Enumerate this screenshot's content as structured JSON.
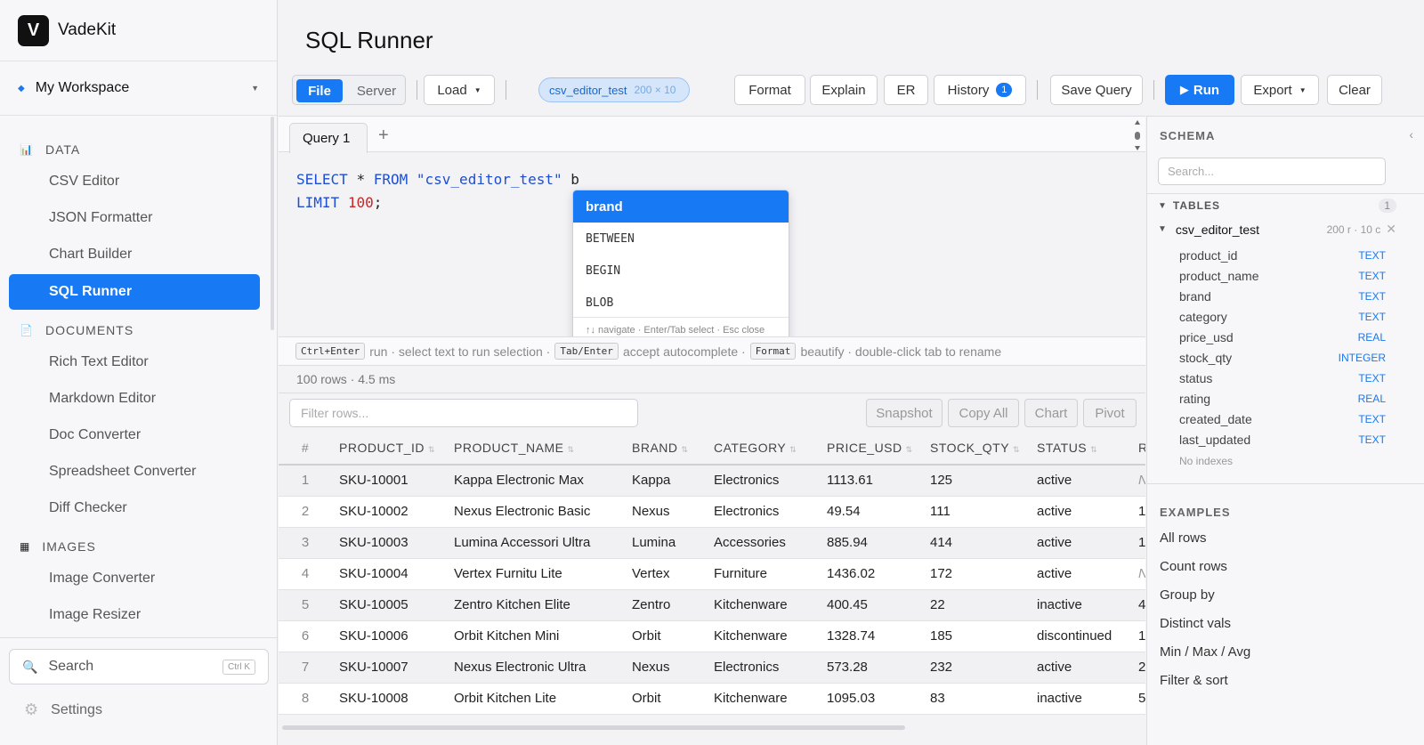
{
  "app": {
    "name": "VadeKit",
    "logo_letter": "V"
  },
  "workspace": {
    "label": "My Workspace"
  },
  "sidebar": {
    "sections": [
      {
        "label": "DATA",
        "icon": "chart-icon",
        "items": [
          "CSV Editor",
          "JSON Formatter",
          "Chart Builder",
          "SQL Runner"
        ]
      },
      {
        "label": "DOCUMENTS",
        "icon": "document-icon",
        "items": [
          "Rich Text Editor",
          "Markdown Editor",
          "Doc Converter",
          "Spreadsheet Converter",
          "Diff Checker"
        ]
      },
      {
        "label": "IMAGES",
        "icon": "image-icon",
        "items": [
          "Image Converter",
          "Image Resizer"
        ]
      }
    ],
    "active_item": "SQL Runner",
    "search": {
      "label": "Search",
      "shortcut": "Ctrl K"
    },
    "settings_label": "Settings"
  },
  "page": {
    "title": "SQL Runner"
  },
  "toolbar": {
    "source_options": [
      "File",
      "Server"
    ],
    "source_selected": "File",
    "load_label": "Load",
    "table_chip": {
      "name": "csv_editor_test",
      "dims": "200 × 10"
    },
    "format_label": "Format",
    "explain_label": "Explain",
    "er_label": "ER",
    "history_label": "History",
    "history_count": "1",
    "save_label": "Save Query",
    "run_label": "Run",
    "export_label": "Export",
    "clear_label": "Clear"
  },
  "editor": {
    "tab_label": "Query 1",
    "add_tab": "+",
    "code": {
      "line1": {
        "select": "SELECT",
        "star": "*",
        "from": "FROM",
        "table": "\"csv_editor_test\"",
        "rest": "b"
      },
      "line2": {
        "limit": "LIMIT",
        "num": "100",
        "end": ";"
      }
    },
    "autocomplete": {
      "items": [
        "brand",
        "BETWEEN",
        "BEGIN",
        "BLOB"
      ],
      "selected": "brand",
      "footer": "↑↓ navigate · Enter/Tab select · Esc close"
    },
    "hints": {
      "k1": "Ctrl+Enter",
      "t1": "run · select text to run selection ·",
      "k2": "Tab/Enter",
      "t2": "accept autocomplete ·",
      "k3": "Format",
      "t3": "beautify · double-click tab to rename"
    }
  },
  "results": {
    "status": "100 rows · 4.5 ms",
    "filter_placeholder": "Filter rows...",
    "actions": [
      "Snapshot",
      "Copy All",
      "Chart",
      "Pivot"
    ],
    "columns": [
      "#",
      "PRODUCT_ID",
      "PRODUCT_NAME",
      "BRAND",
      "CATEGORY",
      "PRICE_USD",
      "STOCK_QTY",
      "STATUS",
      "RA"
    ],
    "rows": [
      [
        "1",
        "SKU-10001",
        "Kappa Electronic Max",
        "Kappa",
        "Electronics",
        "1113.61",
        "125",
        "active",
        "N"
      ],
      [
        "2",
        "SKU-10002",
        "Nexus Electronic Basic",
        "Nexus",
        "Electronics",
        "49.54",
        "111",
        "active",
        "1."
      ],
      [
        "3",
        "SKU-10003",
        "Lumina Accessori Ultra",
        "Lumina",
        "Accessories",
        "885.94",
        "414",
        "active",
        "1."
      ],
      [
        "4",
        "SKU-10004",
        "Vertex Furnitu Lite",
        "Vertex",
        "Furniture",
        "1436.02",
        "172",
        "active",
        "N"
      ],
      [
        "5",
        "SKU-10005",
        "Zentro Kitchen Elite",
        "Zentro",
        "Kitchenware",
        "400.45",
        "22",
        "inactive",
        "4."
      ],
      [
        "6",
        "SKU-10006",
        "Orbit Kitchen Mini",
        "Orbit",
        "Kitchenware",
        "1328.74",
        "185",
        "discontinued",
        "1."
      ],
      [
        "7",
        "SKU-10007",
        "Nexus Electronic Ultra",
        "Nexus",
        "Electronics",
        "573.28",
        "232",
        "active",
        "2."
      ],
      [
        "8",
        "SKU-10008",
        "Orbit Kitchen Lite",
        "Orbit",
        "Kitchenware",
        "1095.03",
        "83",
        "inactive",
        "5"
      ]
    ]
  },
  "schema": {
    "title": "SCHEMA",
    "collapse": "‹",
    "search_placeholder": "Search...",
    "tables_label": "TABLES",
    "tables_count": "1",
    "table": {
      "name": "csv_editor_test",
      "meta": "200 r · 10 c"
    },
    "columns": [
      {
        "name": "product_id",
        "type": "TEXT"
      },
      {
        "name": "product_name",
        "type": "TEXT"
      },
      {
        "name": "brand",
        "type": "TEXT"
      },
      {
        "name": "category",
        "type": "TEXT"
      },
      {
        "name": "price_usd",
        "type": "REAL"
      },
      {
        "name": "stock_qty",
        "type": "INTEGER"
      },
      {
        "name": "status",
        "type": "TEXT"
      },
      {
        "name": "rating",
        "type": "REAL"
      },
      {
        "name": "created_date",
        "type": "TEXT"
      },
      {
        "name": "last_updated",
        "type": "TEXT"
      }
    ],
    "no_indexes": "No indexes",
    "examples_title": "EXAMPLES",
    "examples": [
      "All rows",
      "Count rows",
      "Group by",
      "Distinct vals",
      "Min / Max / Avg",
      "Filter & sort"
    ]
  },
  "colors": {
    "accent": "#1779f3",
    "keyword": "#1d4fd0",
    "number": "#c62828"
  }
}
